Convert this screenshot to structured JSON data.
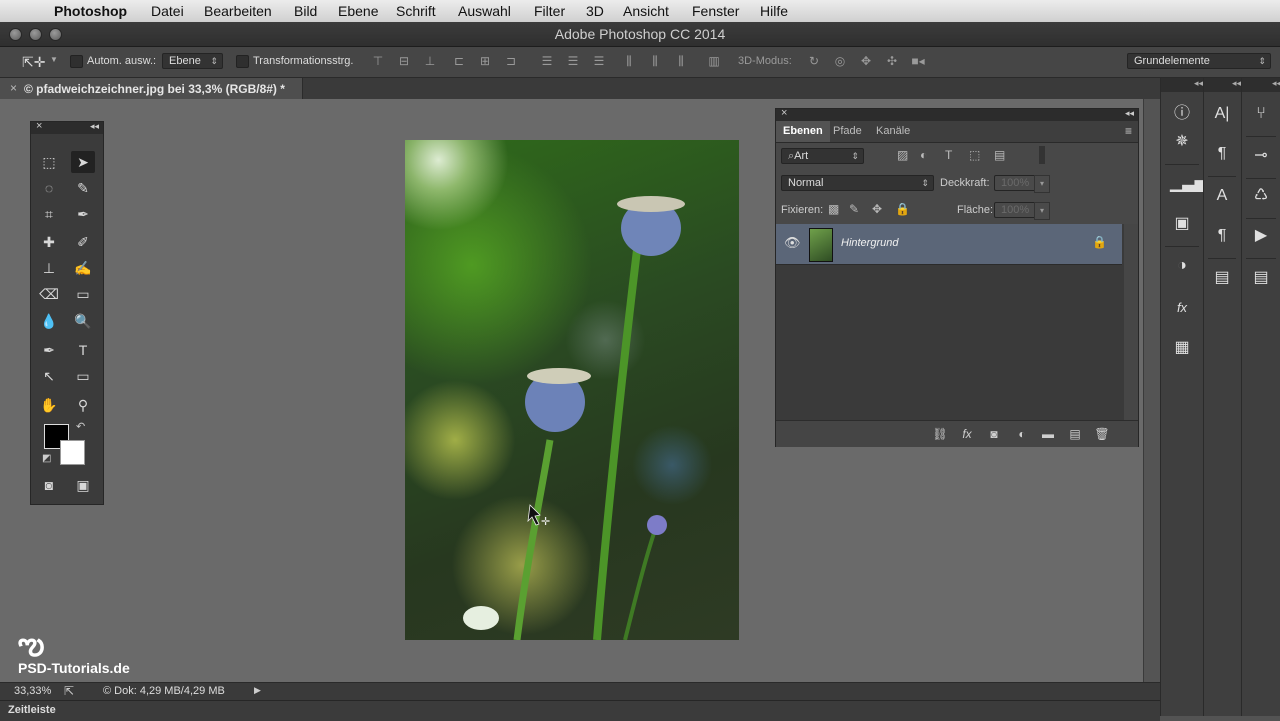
{
  "menubar": {
    "app": "Photoshop",
    "items": [
      "Datei",
      "Bearbeiten",
      "Bild",
      "Ebene",
      "Schrift",
      "Auswahl",
      "Filter",
      "3D",
      "Ansicht",
      "Fenster",
      "Hilfe"
    ]
  },
  "window": {
    "title": "Adobe Photoshop CC 2014"
  },
  "options": {
    "auto_select_label": "Autom. ausw.:",
    "auto_select_value": "Ebene",
    "transform_label": "Transformationsstrg.",
    "mode_3d_label": "3D-Modus:",
    "workspace": "Grundelemente"
  },
  "document": {
    "tab_title": "© pfadweichzeichner.jpg bei 33,3% (RGB/8#) *"
  },
  "layers_panel": {
    "tabs": [
      "Ebenen",
      "Pfade",
      "Kanäle"
    ],
    "filter_label": "Art",
    "blend_mode": "Normal",
    "opacity_label": "Deckkraft:",
    "opacity_value": "100%",
    "lock_label": "Fixieren:",
    "fill_label": "Fläche:",
    "fill_value": "100%",
    "layers": [
      {
        "name": "Hintergrund",
        "visible": true,
        "locked": true
      }
    ]
  },
  "status": {
    "zoom": "33,33%",
    "doc_info": "© Dok: 4,29 MB/4,29 MB"
  },
  "timeline": {
    "label": "Zeitleiste"
  },
  "watermark": {
    "text": "PSD-Tutorials.de"
  },
  "colors": {
    "canvas_bg": "#6a6a6a",
    "panel_bg": "#535353",
    "layer_selected": "#5b6678"
  }
}
